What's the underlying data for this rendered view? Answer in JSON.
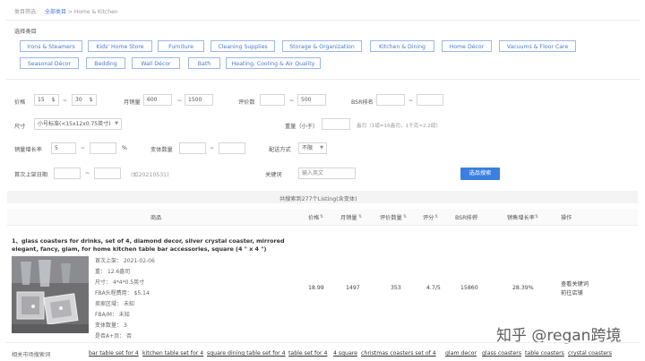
{
  "breadcrumb": {
    "label": "类目筛选:",
    "all": "全部类目",
    "sep": ">",
    "current": "Home & Kitchen"
  },
  "category_section": {
    "title": "选择类目"
  },
  "categories_row1": [
    "Irons & Steamers",
    "Kids' Home Store",
    "Furniture",
    "Cleaning Supplies",
    "Storage & Organization",
    "Kitchen & Dining",
    "Home Décor",
    "Vacuums & Floor Care"
  ],
  "categories_row2": [
    "Seasonal Décor",
    "Bedding",
    "Wall Décor",
    "Bath",
    "Heating, Cooling & Air Quality"
  ],
  "filters": {
    "price": {
      "label": "价格",
      "min": "15",
      "min_unit": "$",
      "max": "30",
      "max_unit": "$",
      "dash": "~"
    },
    "monthly_sales": {
      "label": "月销量",
      "min": "600",
      "max": "1500",
      "dash": "~"
    },
    "reviews": {
      "label": "评价数",
      "min": "",
      "max": "500",
      "dash": "~"
    },
    "bsr": {
      "label": "BSR排名",
      "min": "",
      "max": "",
      "dash": "~"
    },
    "size": {
      "label": "尺寸",
      "value": "小号标准(<15x12x0.75英寸)"
    },
    "weight": {
      "label": "重量（小于）",
      "unit_note": "盎司（1磅=16盎司，1千克=2.2磅）"
    },
    "sales_growth": {
      "label": "销量增长率",
      "min": "5",
      "max": "",
      "unit": "%",
      "dash": "~"
    },
    "variants": {
      "label": "变体数量",
      "min": "",
      "max": "",
      "dash": "~"
    },
    "fulfillment": {
      "label": "配送方式",
      "value": "不限"
    },
    "first_listed": {
      "label": "首次上架日期",
      "from": "",
      "to": "",
      "dash": "~",
      "hint": "(如20210531)"
    },
    "keyword": {
      "label": "关键词",
      "placeholder": "输入英文"
    },
    "search_button": "选品搜索"
  },
  "results": {
    "summary": "共搜索到277个Listing(含变体)",
    "headers": {
      "product": "商品",
      "price": "价格",
      "monthly_sales": "月销量",
      "reviews": "评价数量",
      "rating": "评分",
      "bsr": "BSR排名",
      "growth": "销售增长率",
      "action": "操作"
    },
    "rows": [
      {
        "index": "1、",
        "title": "glass coasters for drinks, set of 4, diamond decor, silver crystal coaster, mirrored elegant, fancy, glam, for home kitchen table bar accessories, square (4 \" x 4 \")",
        "details": [
          {
            "label": "首次上架：",
            "value": "2021-02-06"
          },
          {
            "label": "重：",
            "value": "12.6盎司"
          },
          {
            "label": "尺寸：",
            "value": "4*4*0.5英寸"
          },
          {
            "label": "FBA头程费用：",
            "value": "$5.14"
          },
          {
            "label": "卖家区域：",
            "value": "未知"
          },
          {
            "label": "FBA/M：",
            "value": "未知"
          },
          {
            "label": "变体数量：",
            "value": "3"
          },
          {
            "label": "是否A+页：",
            "value": "否"
          }
        ],
        "price": "18.99",
        "monthly_sales": "1497",
        "reviews": "353",
        "rating": "4.7/5",
        "bsr": "15860",
        "growth": "28.39%",
        "actions": [
          "查看关键词",
          "前往店铺"
        ]
      }
    ]
  },
  "related_keywords": {
    "label": "相关市场搜索词",
    "items": [
      "bar table set for 4",
      "kitchen table set for 4",
      "square dining table set for 4",
      "table set for 4",
      "4 square",
      "christmas coasters set of 4",
      "glam decor",
      "glass coasters",
      "table coasters",
      "crystal coasters"
    ]
  },
  "watermark": {
    "text": "知乎 @regan跨境"
  }
}
